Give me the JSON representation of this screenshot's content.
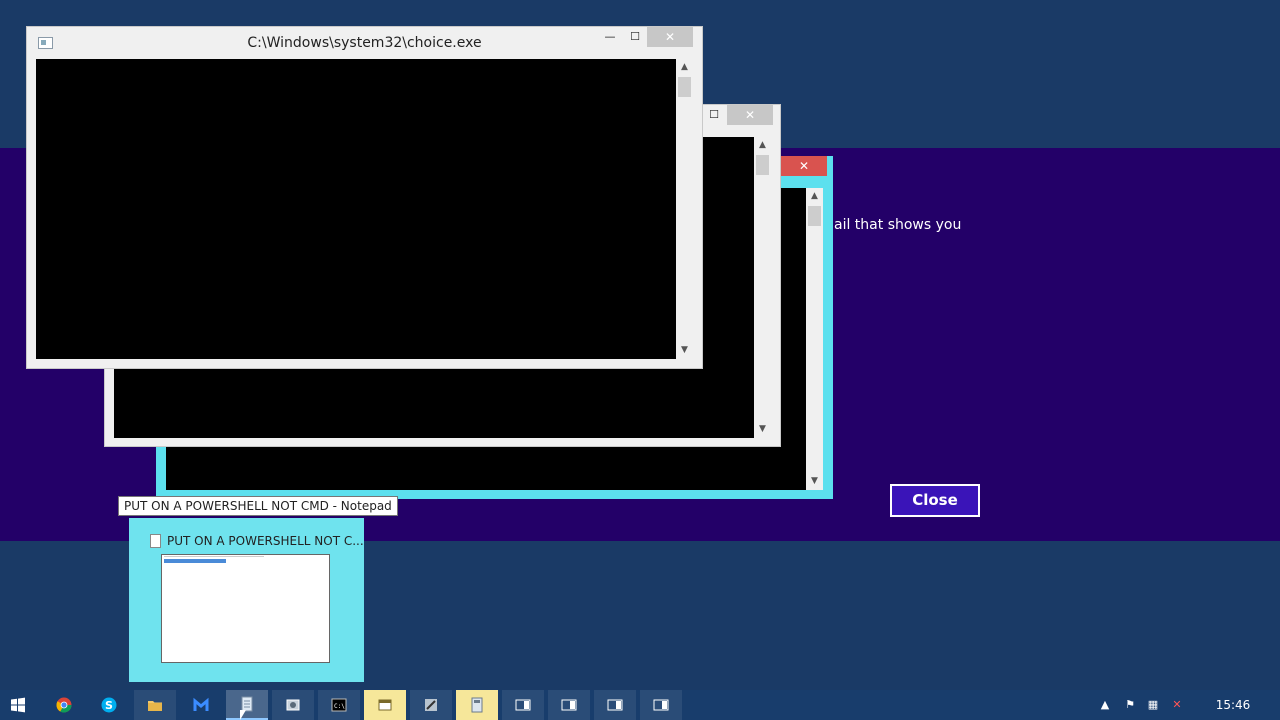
{
  "windows": {
    "front": {
      "title": "C:\\Windows\\system32\\choice.exe",
      "minimize_glyph": "—",
      "maximize_glyph": "☐",
      "close_glyph": "✕"
    },
    "middle": {
      "maximize_glyph": "☐",
      "close_glyph": "✕"
    },
    "back": {
      "close_glyph": "✕"
    }
  },
  "background_app": {
    "text": "ail that shows you",
    "close_label": "Close",
    "accent": "#230068"
  },
  "tooltip": {
    "text": "PUT ON A POWERSHELL NOT CMD - Notepad"
  },
  "thumbnail": {
    "title": "PUT ON A POWERSHELL NOT C..."
  },
  "taskbar": {
    "clock": "15:46",
    "items": [
      {
        "name": "start",
        "icon": "windows-logo-icon"
      },
      {
        "name": "chrome",
        "icon": "chrome-icon"
      },
      {
        "name": "skype",
        "icon": "skype-icon"
      },
      {
        "name": "file-explorer",
        "icon": "folder-icon"
      },
      {
        "name": "malwarebytes",
        "icon": "malwarebytes-icon"
      },
      {
        "name": "notepad",
        "icon": "notepad-icon"
      },
      {
        "name": "control-panel",
        "icon": "settings-icon"
      },
      {
        "name": "cmd",
        "icon": "console-icon",
        "glyph": "C:\\"
      },
      {
        "name": "window",
        "icon": "window-icon"
      },
      {
        "name": "tool",
        "icon": "tool-icon"
      },
      {
        "name": "calculator",
        "icon": "calculator-icon"
      },
      {
        "name": "app-1",
        "icon": "app-icon"
      },
      {
        "name": "app-2",
        "icon": "app-icon"
      },
      {
        "name": "app-3",
        "icon": "app-icon"
      },
      {
        "name": "app-4",
        "icon": "app-icon"
      }
    ],
    "tray": {
      "chevron": "▲",
      "flag": "⚑",
      "network": "▦",
      "volume": "✕"
    }
  }
}
